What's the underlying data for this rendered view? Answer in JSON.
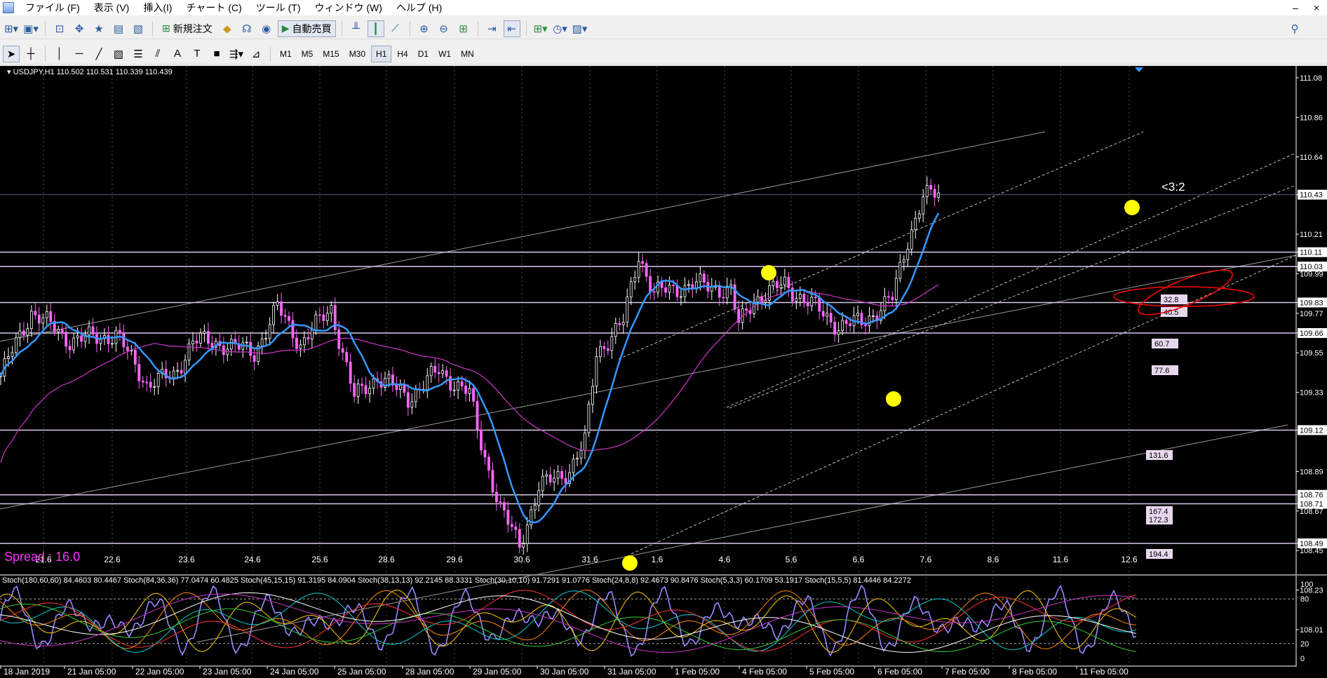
{
  "menu": {
    "items": [
      "ファイル (F)",
      "表示 (V)",
      "挿入(I)",
      "チャート (C)",
      "ツール (T)",
      "ウィンドウ (W)",
      "ヘルプ (H)"
    ],
    "minimize": "‒",
    "close": "×"
  },
  "toolbar": {
    "new_order_label": "新規注文",
    "auto_trade_label": "自動売買"
  },
  "timeframes": [
    "M1",
    "M5",
    "M15",
    "M30",
    "H1",
    "H4",
    "D1",
    "W1",
    "MN"
  ],
  "active_timeframe": "H1",
  "chart": {
    "info": "USDJPY,H1  110.502 110.531 110.339 110.439",
    "spread_label": "Spread : 16.0",
    "ratio_label": "<3:2",
    "price_axis": [
      "111.08",
      "110.86",
      "110.64",
      "110.43",
      "110.21",
      "110.11",
      "110.03",
      "109.99",
      "109.83",
      "109.77",
      "109.66",
      "109.55",
      "109.33",
      "109.12",
      "108.89",
      "108.76",
      "108.71",
      "108.67",
      "108.49",
      "108.45",
      "108.23",
      "108.01"
    ],
    "level_labels": [
      "32.8",
      "40.5",
      "60.7",
      "77.6",
      "131.6",
      "167.4",
      "172.3",
      "194.4"
    ],
    "session_labels": [
      "21.6",
      "22.6",
      "23.6",
      "24.6",
      "25.6",
      "28.6",
      "29.6",
      "30.6",
      "31.6",
      "1.6",
      "4.6",
      "5.6",
      "6.6",
      "7.6",
      "8.6",
      "11.6",
      "12.6"
    ],
    "time_axis": [
      "18 Jan 2019",
      "21 Jan 05:00",
      "22 Jan 05:00",
      "23 Jan 05:00",
      "24 Jan 05:00",
      "25 Jan 05:00",
      "28 Jan 05:00",
      "29 Jan 05:00",
      "30 Jan 05:00",
      "31 Jan 05:00",
      "1 Feb 05:00",
      "4 Feb 05:00",
      "5 Feb 05:00",
      "6 Feb 05:00",
      "7 Feb 05:00",
      "8 Feb 05:00",
      "11 Feb 05:00"
    ],
    "stoch_axis": [
      "100",
      "80",
      "20",
      "0"
    ],
    "stoch_info": "Stoch(180,60,60) 84.4603 80.4467  Stoch(84,36,36) 77.0474 60.4825  Stoch(45,15,15) 91.3195 84.0904  Stoch(38,13,13) 92.2145 88.3331  Stoch(30,10,10) 91.7291 91.0776  Stoch(24,8,8) 92.4673 90.8476  Stoch(5,3,3) 60.1709 53.1917  Stoch(15,5,5) 81.4446 84.2272",
    "colors": {
      "background": "#000000",
      "candle_up": "#ffffff",
      "candle_down": "#ff66ff",
      "ma_fast": "#3399ff",
      "ma_slow": "#cc33cc",
      "marker": "#ffff00",
      "spread": "#ff33ff",
      "level_line": "#d8c8e8",
      "ellipse": "#ff0000"
    }
  }
}
